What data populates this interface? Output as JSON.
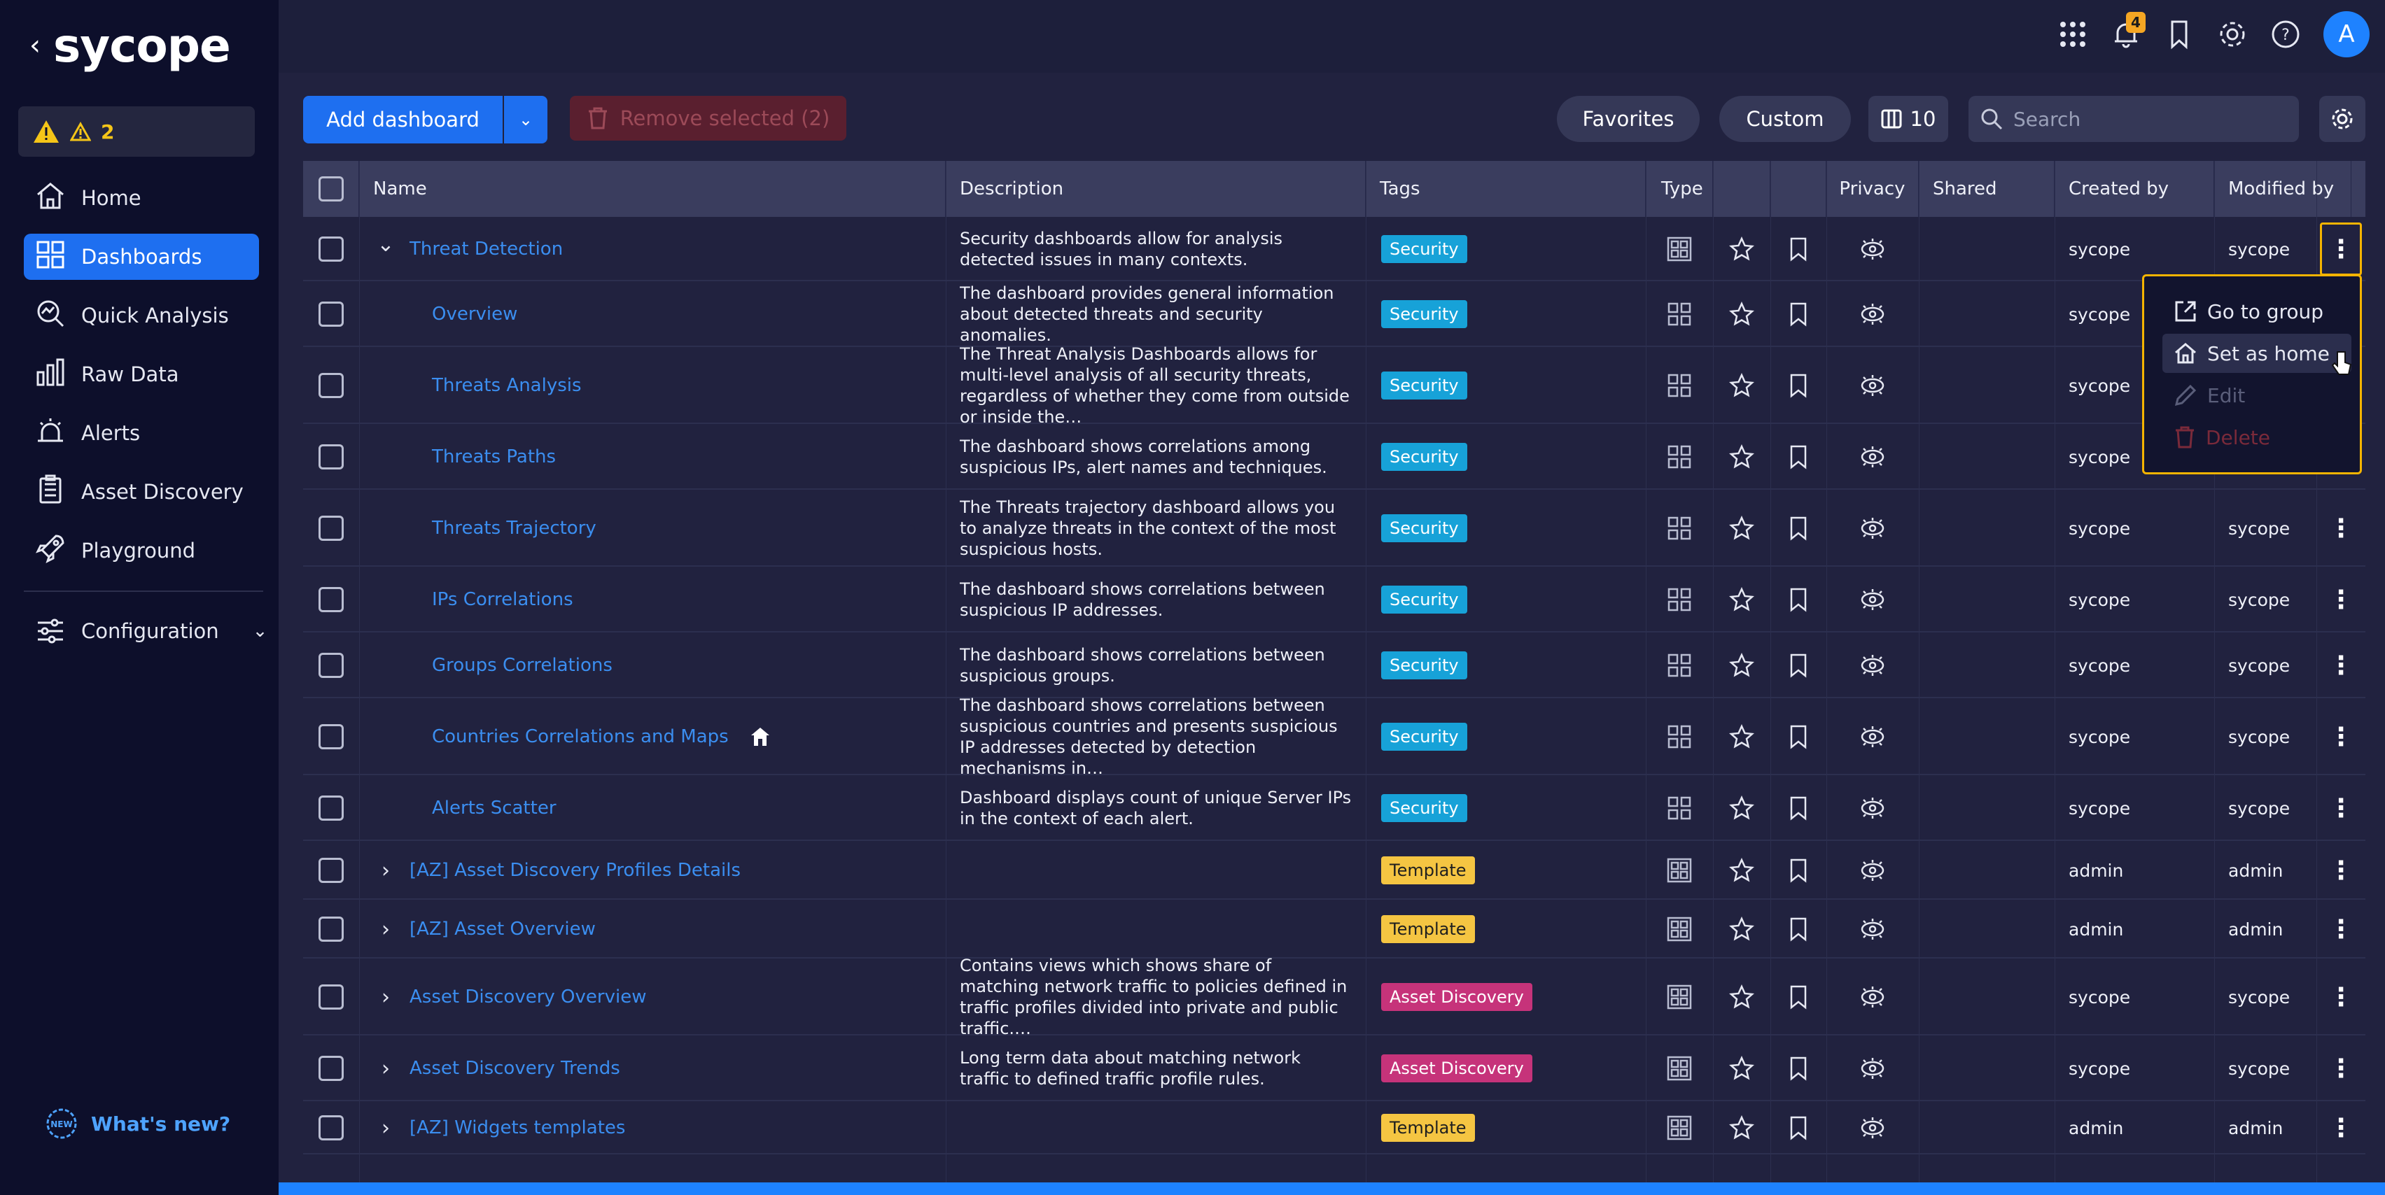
{
  "app": {
    "logo_text": "sycope",
    "back": "‹"
  },
  "alerts_count": "2",
  "nav": [
    {
      "label": "Home",
      "icon": "home-icon"
    },
    {
      "label": "Dashboards",
      "icon": "dashboards-icon",
      "active": true
    },
    {
      "label": "Quick Analysis",
      "icon": "quick-analysis-icon"
    },
    {
      "label": "Raw Data",
      "icon": "raw-data-icon"
    },
    {
      "label": "Alerts",
      "icon": "alerts-icon"
    },
    {
      "label": "Asset Discovery",
      "icon": "asset-discovery-icon"
    },
    {
      "label": "Playground",
      "icon": "playground-icon"
    }
  ],
  "configuration_label": "Configuration",
  "whats_new": "What's new?",
  "topbar": {
    "notifications_count": "4",
    "avatar_letter": "A"
  },
  "toolbar": {
    "add_dashboard": "Add dashboard",
    "remove_selected": "Remove selected (2)",
    "favorites": "Favorites",
    "custom": "Custom",
    "columns_count": "10",
    "search_placeholder": "Search"
  },
  "table": {
    "headers": {
      "name": "Name",
      "description": "Description",
      "tags": "Tags",
      "type": "Type",
      "privacy": "Privacy",
      "shared": "Shared",
      "created_by": "Created by",
      "modified_by": "Modified by"
    },
    "rows": [
      {
        "name": "Threat Detection",
        "group": true,
        "expanded": true,
        "desc": "Security dashboards allow for analysis detected issues in many contexts.",
        "tag": "Security",
        "tag_type": "security",
        "created": "sycope",
        "modified": "sycope"
      },
      {
        "name": "Overview",
        "desc": "The dashboard provides general information about detected threats and security anomalies.",
        "tag": "Security",
        "tag_type": "security",
        "created": "sycope",
        "modified": ""
      },
      {
        "name": "Threats Analysis",
        "desc": "The Threat Analysis Dashboards allows for multi-level analysis of all security threats, regardless of whether they come from outside or inside the…",
        "tag": "Security",
        "tag_type": "security",
        "created": "sycope",
        "modified": ""
      },
      {
        "name": "Threats Paths",
        "desc": "The dashboard shows correlations among suspicious IPs, alert names and techniques.",
        "tag": "Security",
        "tag_type": "security",
        "created": "sycope",
        "modified": ""
      },
      {
        "name": "Threats Trajectory",
        "desc": "The Threats trajectory dashboard allows you to analyze threats in the context of the most suspicious hosts.",
        "tag": "Security",
        "tag_type": "security",
        "created": "sycope",
        "modified": "sycope"
      },
      {
        "name": "IPs Correlations",
        "desc": "The dashboard shows correlations between suspicious IP addresses.",
        "tag": "Security",
        "tag_type": "security",
        "created": "sycope",
        "modified": "sycope"
      },
      {
        "name": "Groups Correlations",
        "desc": "The dashboard shows correlations between suspicious groups.",
        "tag": "Security",
        "tag_type": "security",
        "created": "sycope",
        "modified": "sycope"
      },
      {
        "name": "Countries Correlations and Maps",
        "home": true,
        "desc": "The dashboard shows correlations between suspicious countries and presents suspicious IP addresses detected by detection mechanisms in…",
        "tag": "Security",
        "tag_type": "security",
        "created": "sycope",
        "modified": "sycope"
      },
      {
        "name": "Alerts Scatter",
        "desc": "Dashboard displays count of unique Server IPs in the context of each alert.",
        "tag": "Security",
        "tag_type": "security",
        "created": "sycope",
        "modified": "sycope"
      },
      {
        "name": "[AZ] Asset Discovery Profiles Details",
        "group": true,
        "desc": "",
        "tag": "Template",
        "tag_type": "template",
        "created": "admin",
        "modified": "admin"
      },
      {
        "name": "[AZ] Asset Overview",
        "group": true,
        "desc": "",
        "tag": "Template",
        "tag_type": "template",
        "created": "admin",
        "modified": "admin"
      },
      {
        "name": "Asset Discovery Overview",
        "group": true,
        "desc": "Contains views which shows share of matching network traffic to policies defined in traffic profiles divided into private and public traffic.…",
        "tag": "Asset Discovery",
        "tag_type": "asset",
        "created": "sycope",
        "modified": "sycope"
      },
      {
        "name": "Asset Discovery Trends",
        "group": true,
        "desc": "Long term data about matching network traffic to defined traffic profile rules.",
        "tag": "Asset Discovery",
        "tag_type": "asset",
        "created": "sycope",
        "modified": "sycope"
      },
      {
        "name": "[AZ] Widgets templates",
        "group": true,
        "desc": "",
        "tag": "Template",
        "tag_type": "template",
        "created": "admin",
        "modified": "admin"
      }
    ]
  },
  "context_menu": {
    "go_to_group": "Go to group",
    "set_as_home": "Set as home",
    "edit": "Edit",
    "delete": "Delete"
  },
  "colors": {
    "accent": "#1e6ff0",
    "highlight": "#f5b400"
  }
}
